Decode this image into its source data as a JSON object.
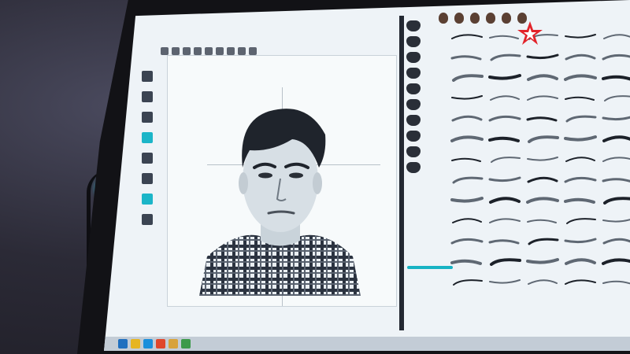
{
  "app": {
    "accent_color": "#17b3c4",
    "canvas_bg": "#f7fafb",
    "panel_bg": "#eef3f7"
  },
  "icons": {
    "toolbar": [
      "open-icon",
      "save-icon",
      "undo-icon",
      "redo-icon",
      "zoom-icon",
      "grid-icon",
      "crop-icon",
      "pen-icon",
      "erase-icon"
    ],
    "side_tools": [
      "select-tool-icon",
      "move-tool-icon",
      "brush-tool-icon",
      "eraser-tool-icon",
      "layer-icon",
      "color-icon",
      "text-icon",
      "zoom-icon"
    ],
    "feature_categories": [
      "face-shape-icon",
      "hair-icon",
      "eyebrows-icon",
      "eyes-icon",
      "nose-icon",
      "lips-icon",
      "ears-icon",
      "beard-icon",
      "glasses-icon",
      "hat-icon"
    ],
    "taskbar": [
      "start-icon",
      "explorer-icon",
      "browser-icon",
      "media-icon",
      "folder-icon",
      "app-icon"
    ]
  },
  "logo": {
    "color": "#e2232a"
  },
  "palette": {
    "item_kind": "eyebrow-shape",
    "rows": 13,
    "cols": 5
  }
}
